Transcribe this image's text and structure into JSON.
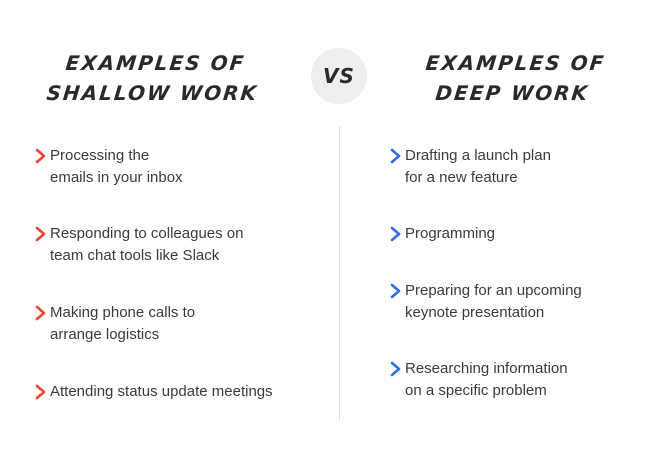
{
  "left": {
    "title": "EXAMPLES OF\nSHALLOW WORK",
    "accent_color": "#e8462e",
    "items": [
      "Processing the\nemails in your inbox",
      "Responding to colleagues on\nteam chat tools like Slack",
      "Making phone calls to\narrange logistics",
      "Attending status update meetings"
    ]
  },
  "vs_label": "VS",
  "right": {
    "title": "EXAMPLES OF\nDEEP WORK",
    "accent_color": "#2f6ee0",
    "items": [
      "Drafting a launch plan\nfor a new feature",
      "Programming",
      "Preparing for an upcoming\nkeynote presentation",
      "Researching information\non a specific problem"
    ]
  },
  "icons": {
    "bullet": "chevron-right-icon"
  }
}
